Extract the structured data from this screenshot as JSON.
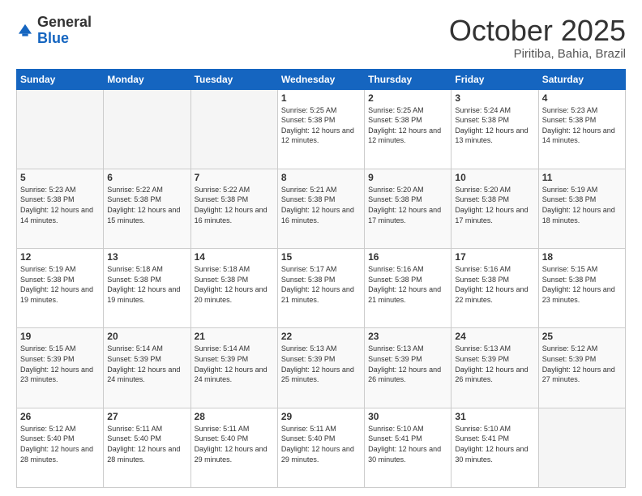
{
  "header": {
    "logo_general": "General",
    "logo_blue": "Blue",
    "month": "October 2025",
    "location": "Piritiba, Bahia, Brazil"
  },
  "weekdays": [
    "Sunday",
    "Monday",
    "Tuesday",
    "Wednesday",
    "Thursday",
    "Friday",
    "Saturday"
  ],
  "rows": [
    [
      {
        "day": "",
        "sunrise": "",
        "sunset": "",
        "daylight": ""
      },
      {
        "day": "",
        "sunrise": "",
        "sunset": "",
        "daylight": ""
      },
      {
        "day": "",
        "sunrise": "",
        "sunset": "",
        "daylight": ""
      },
      {
        "day": "1",
        "sunrise": "Sunrise: 5:25 AM",
        "sunset": "Sunset: 5:38 PM",
        "daylight": "Daylight: 12 hours and 12 minutes."
      },
      {
        "day": "2",
        "sunrise": "Sunrise: 5:25 AM",
        "sunset": "Sunset: 5:38 PM",
        "daylight": "Daylight: 12 hours and 12 minutes."
      },
      {
        "day": "3",
        "sunrise": "Sunrise: 5:24 AM",
        "sunset": "Sunset: 5:38 PM",
        "daylight": "Daylight: 12 hours and 13 minutes."
      },
      {
        "day": "4",
        "sunrise": "Sunrise: 5:23 AM",
        "sunset": "Sunset: 5:38 PM",
        "daylight": "Daylight: 12 hours and 14 minutes."
      }
    ],
    [
      {
        "day": "5",
        "sunrise": "Sunrise: 5:23 AM",
        "sunset": "Sunset: 5:38 PM",
        "daylight": "Daylight: 12 hours and 14 minutes."
      },
      {
        "day": "6",
        "sunrise": "Sunrise: 5:22 AM",
        "sunset": "Sunset: 5:38 PM",
        "daylight": "Daylight: 12 hours and 15 minutes."
      },
      {
        "day": "7",
        "sunrise": "Sunrise: 5:22 AM",
        "sunset": "Sunset: 5:38 PM",
        "daylight": "Daylight: 12 hours and 16 minutes."
      },
      {
        "day": "8",
        "sunrise": "Sunrise: 5:21 AM",
        "sunset": "Sunset: 5:38 PM",
        "daylight": "Daylight: 12 hours and 16 minutes."
      },
      {
        "day": "9",
        "sunrise": "Sunrise: 5:20 AM",
        "sunset": "Sunset: 5:38 PM",
        "daylight": "Daylight: 12 hours and 17 minutes."
      },
      {
        "day": "10",
        "sunrise": "Sunrise: 5:20 AM",
        "sunset": "Sunset: 5:38 PM",
        "daylight": "Daylight: 12 hours and 17 minutes."
      },
      {
        "day": "11",
        "sunrise": "Sunrise: 5:19 AM",
        "sunset": "Sunset: 5:38 PM",
        "daylight": "Daylight: 12 hours and 18 minutes."
      }
    ],
    [
      {
        "day": "12",
        "sunrise": "Sunrise: 5:19 AM",
        "sunset": "Sunset: 5:38 PM",
        "daylight": "Daylight: 12 hours and 19 minutes."
      },
      {
        "day": "13",
        "sunrise": "Sunrise: 5:18 AM",
        "sunset": "Sunset: 5:38 PM",
        "daylight": "Daylight: 12 hours and 19 minutes."
      },
      {
        "day": "14",
        "sunrise": "Sunrise: 5:18 AM",
        "sunset": "Sunset: 5:38 PM",
        "daylight": "Daylight: 12 hours and 20 minutes."
      },
      {
        "day": "15",
        "sunrise": "Sunrise: 5:17 AM",
        "sunset": "Sunset: 5:38 PM",
        "daylight": "Daylight: 12 hours and 21 minutes."
      },
      {
        "day": "16",
        "sunrise": "Sunrise: 5:16 AM",
        "sunset": "Sunset: 5:38 PM",
        "daylight": "Daylight: 12 hours and 21 minutes."
      },
      {
        "day": "17",
        "sunrise": "Sunrise: 5:16 AM",
        "sunset": "Sunset: 5:38 PM",
        "daylight": "Daylight: 12 hours and 22 minutes."
      },
      {
        "day": "18",
        "sunrise": "Sunrise: 5:15 AM",
        "sunset": "Sunset: 5:38 PM",
        "daylight": "Daylight: 12 hours and 23 minutes."
      }
    ],
    [
      {
        "day": "19",
        "sunrise": "Sunrise: 5:15 AM",
        "sunset": "Sunset: 5:39 PM",
        "daylight": "Daylight: 12 hours and 23 minutes."
      },
      {
        "day": "20",
        "sunrise": "Sunrise: 5:14 AM",
        "sunset": "Sunset: 5:39 PM",
        "daylight": "Daylight: 12 hours and 24 minutes."
      },
      {
        "day": "21",
        "sunrise": "Sunrise: 5:14 AM",
        "sunset": "Sunset: 5:39 PM",
        "daylight": "Daylight: 12 hours and 24 minutes."
      },
      {
        "day": "22",
        "sunrise": "Sunrise: 5:13 AM",
        "sunset": "Sunset: 5:39 PM",
        "daylight": "Daylight: 12 hours and 25 minutes."
      },
      {
        "day": "23",
        "sunrise": "Sunrise: 5:13 AM",
        "sunset": "Sunset: 5:39 PM",
        "daylight": "Daylight: 12 hours and 26 minutes."
      },
      {
        "day": "24",
        "sunrise": "Sunrise: 5:13 AM",
        "sunset": "Sunset: 5:39 PM",
        "daylight": "Daylight: 12 hours and 26 minutes."
      },
      {
        "day": "25",
        "sunrise": "Sunrise: 5:12 AM",
        "sunset": "Sunset: 5:39 PM",
        "daylight": "Daylight: 12 hours and 27 minutes."
      }
    ],
    [
      {
        "day": "26",
        "sunrise": "Sunrise: 5:12 AM",
        "sunset": "Sunset: 5:40 PM",
        "daylight": "Daylight: 12 hours and 28 minutes."
      },
      {
        "day": "27",
        "sunrise": "Sunrise: 5:11 AM",
        "sunset": "Sunset: 5:40 PM",
        "daylight": "Daylight: 12 hours and 28 minutes."
      },
      {
        "day": "28",
        "sunrise": "Sunrise: 5:11 AM",
        "sunset": "Sunset: 5:40 PM",
        "daylight": "Daylight: 12 hours and 29 minutes."
      },
      {
        "day": "29",
        "sunrise": "Sunrise: 5:11 AM",
        "sunset": "Sunset: 5:40 PM",
        "daylight": "Daylight: 12 hours and 29 minutes."
      },
      {
        "day": "30",
        "sunrise": "Sunrise: 5:10 AM",
        "sunset": "Sunset: 5:41 PM",
        "daylight": "Daylight: 12 hours and 30 minutes."
      },
      {
        "day": "31",
        "sunrise": "Sunrise: 5:10 AM",
        "sunset": "Sunset: 5:41 PM",
        "daylight": "Daylight: 12 hours and 30 minutes."
      },
      {
        "day": "",
        "sunrise": "",
        "sunset": "",
        "daylight": ""
      }
    ]
  ]
}
